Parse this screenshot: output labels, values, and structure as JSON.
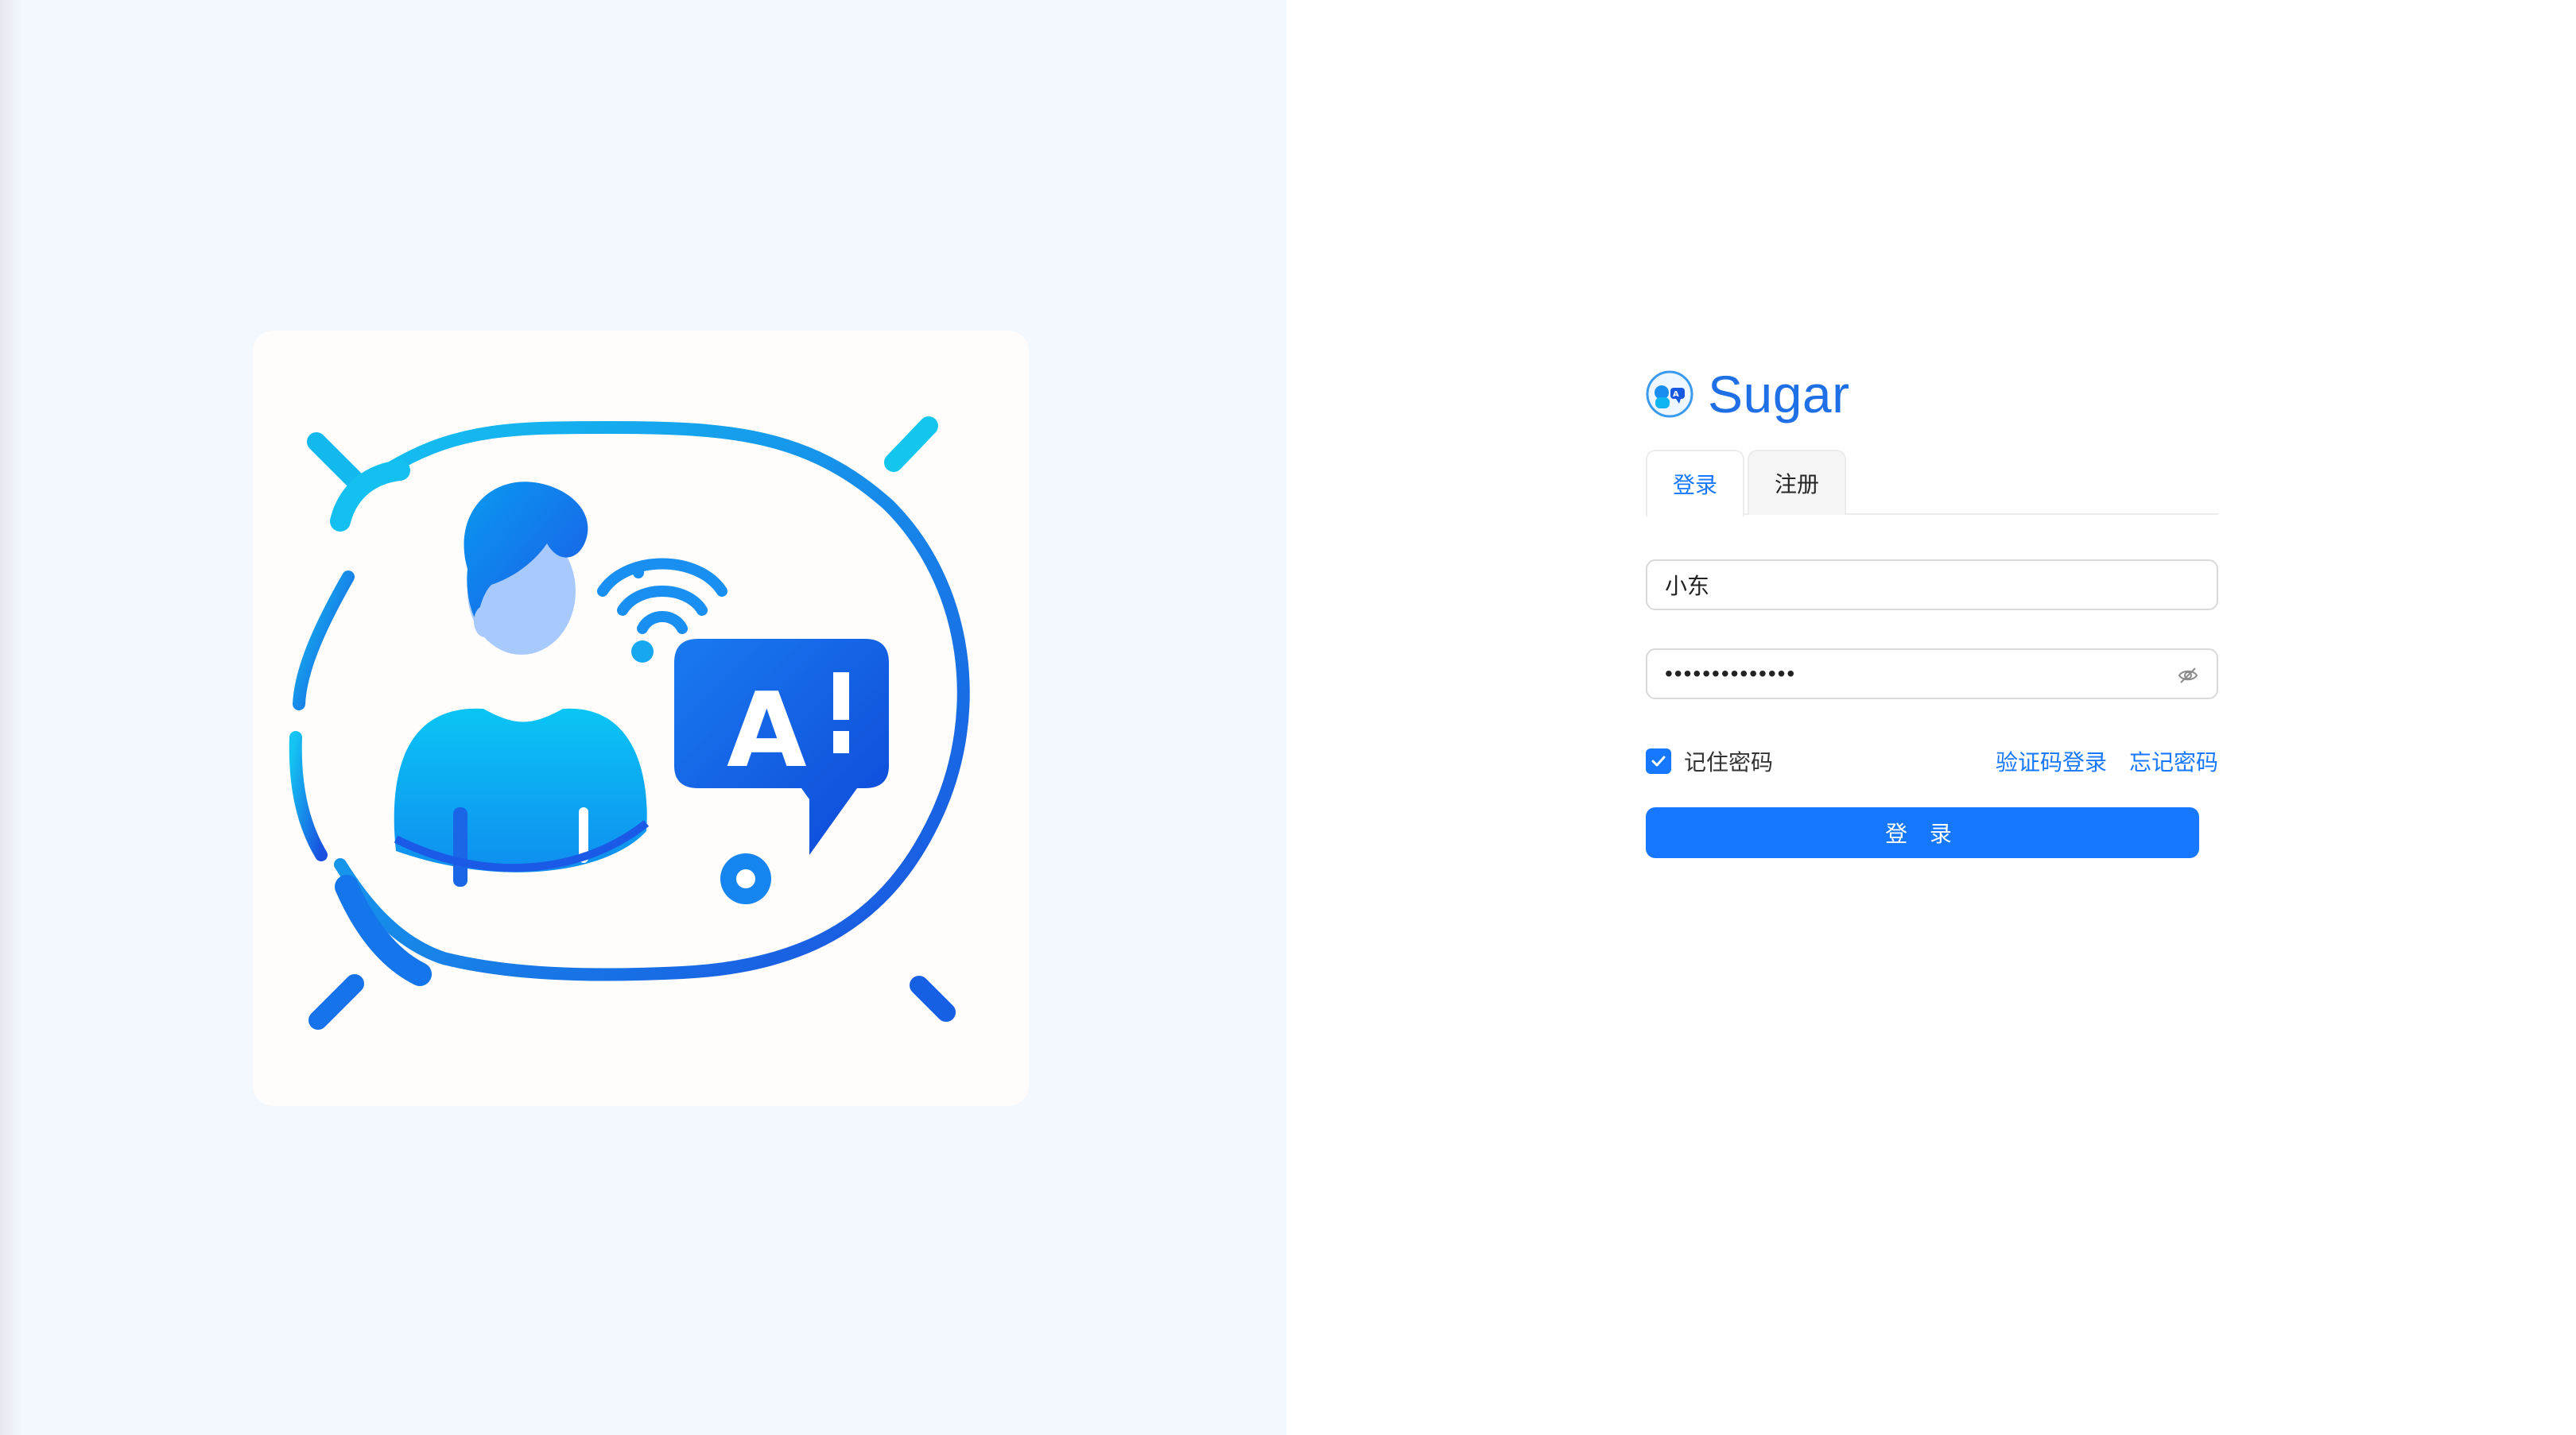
{
  "brand": {
    "name": "Sugar",
    "logo_icon": "robot-chat-logo-icon"
  },
  "tabs": [
    {
      "label": "登录",
      "active": true
    },
    {
      "label": "注册",
      "active": false
    }
  ],
  "form": {
    "username_value": "小东",
    "password_mask": "••••••••••••••",
    "password_visibility_icon": "eye-off-icon",
    "remember_label": "记住密码",
    "remember_checked": true,
    "sms_login_link": "验证码登录",
    "forgot_password_link": "忘记密码",
    "submit_label": "登 录"
  },
  "illustration": {
    "badge_text": "A!",
    "icons": [
      "person-icon",
      "wifi-signal-icon",
      "ai-speech-bubble-icon"
    ]
  },
  "colors": {
    "primary": "#1677ff",
    "brand": "#1f6fe6",
    "left_bg": "#f3f7fe"
  }
}
